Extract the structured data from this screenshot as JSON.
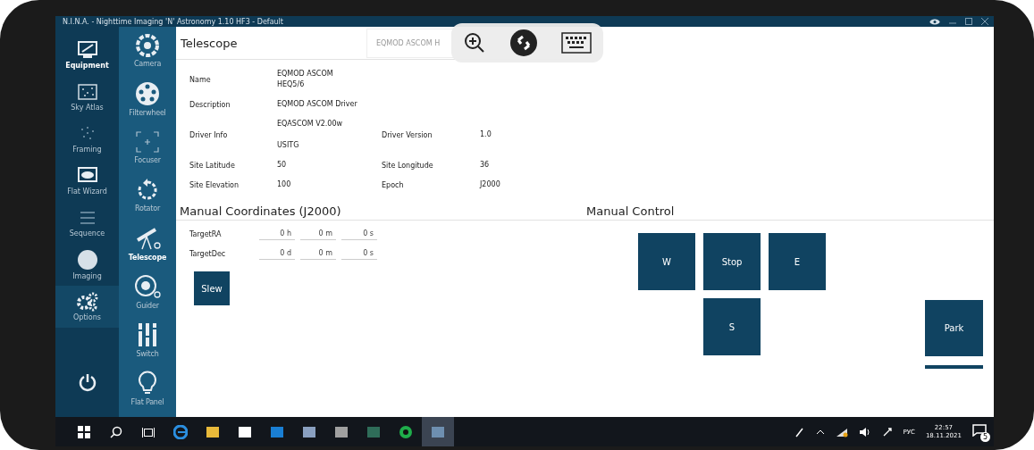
{
  "window": {
    "title": "N.I.N.A. - Nighttime Imaging 'N' Astronomy 1.10 HF3 - Default"
  },
  "sidebar": {
    "items": [
      {
        "label": "Equipment",
        "selected": true
      },
      {
        "label": "Sky Atlas",
        "selected": false
      },
      {
        "label": "Framing",
        "selected": false
      },
      {
        "label": "Flat Wizard",
        "selected": false
      },
      {
        "label": "Sequence",
        "selected": false
      },
      {
        "label": "Imaging",
        "selected": false
      },
      {
        "label": "Options",
        "selected": false
      }
    ]
  },
  "equipment_menu": {
    "items": [
      {
        "label": "Camera",
        "selected": false
      },
      {
        "label": "Filterwheel",
        "selected": false
      },
      {
        "label": "Focuser",
        "selected": false
      },
      {
        "label": "Rotator",
        "selected": false
      },
      {
        "label": "Telescope",
        "selected": true
      },
      {
        "label": "Guider",
        "selected": false
      },
      {
        "label": "Switch",
        "selected": false
      },
      {
        "label": "Flat Panel",
        "selected": false
      }
    ]
  },
  "panel": {
    "title": "Telescope",
    "device_selector": {
      "value": "EQMOD ASCOM H"
    }
  },
  "info": {
    "rows": [
      {
        "pairs": [
          {
            "label": "Name",
            "value": "EQMOD ASCOM\nHEQ5/6"
          }
        ]
      },
      {
        "pairs": [
          {
            "label": "Description",
            "value": "EQMOD ASCOM Driver"
          }
        ]
      },
      {
        "pairs": [
          {
            "label": "Driver Info",
            "value": "EQASCOM V2.00w\n\nUSITG"
          },
          {
            "label": "Driver Version",
            "value": "1.0"
          }
        ]
      },
      {
        "pairs": [
          {
            "label": "Site Latitude",
            "value": "50"
          },
          {
            "label": "Site Longitude",
            "value": "36"
          }
        ]
      },
      {
        "pairs": [
          {
            "label": "Site Elevation",
            "value": "100"
          },
          {
            "label": "Epoch",
            "value": "J2000"
          }
        ]
      }
    ]
  },
  "manual_coordinates": {
    "title": "Manual Coordinates (J2000)",
    "rows": [
      {
        "label": "TargetRA",
        "fields": [
          {
            "value": "0",
            "unit": "h"
          },
          {
            "value": "0",
            "unit": "m"
          },
          {
            "value": "0",
            "unit": "s"
          }
        ]
      },
      {
        "label": "TargetDec",
        "fields": [
          {
            "value": "0",
            "unit": "d"
          },
          {
            "value": "0",
            "unit": "m"
          },
          {
            "value": "0",
            "unit": "s"
          }
        ]
      }
    ],
    "button": "Slew"
  },
  "manual_control": {
    "title": "Manual Control",
    "buttons": [
      "W",
      "Stop",
      "E",
      "S"
    ],
    "park_button": "Park"
  },
  "taskbar": {
    "language": "РУС",
    "time": "22:57",
    "date": "18.11.2021",
    "notifications": "5"
  }
}
